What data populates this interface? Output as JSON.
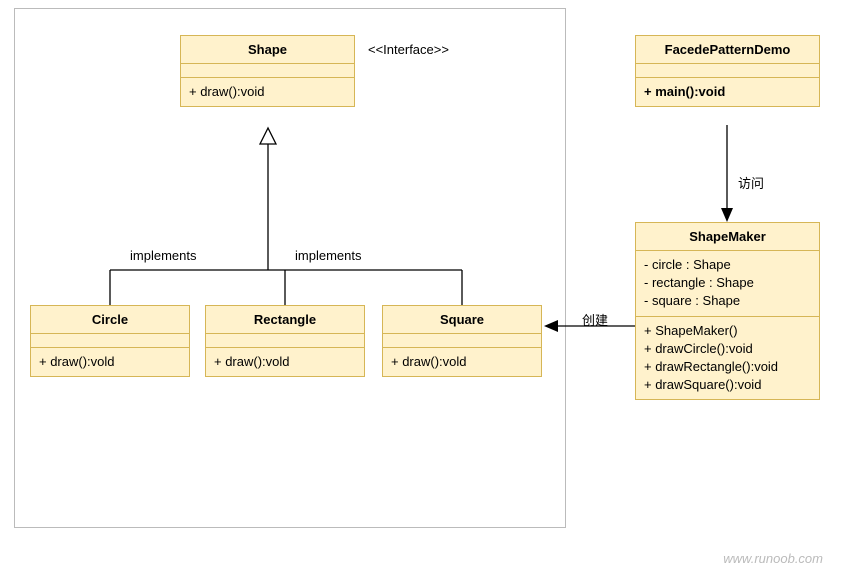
{
  "interfaceLabel": "<<Interface>>",
  "implementsLabel": "implements",
  "visitLabel": "访问",
  "createLabel": "创建",
  "attribution": "www.runoob.com",
  "shape": {
    "name": "Shape",
    "method1": "+ draw():void"
  },
  "circle": {
    "name": "Circle",
    "method1": "+ draw():vold"
  },
  "rectangle": {
    "name": "Rectangle",
    "method1": "+ draw():vold"
  },
  "square": {
    "name": "Square",
    "method1": "+ draw():vold"
  },
  "demo": {
    "name": "FacedePatternDemo",
    "method1": "+ main():void"
  },
  "maker": {
    "name": "ShapeMaker",
    "attr1": "- circle : Shape",
    "attr2": "- rectangle : Shape",
    "attr3": "- square : Shape",
    "method1": "+ ShapeMaker()",
    "method2": "+ drawCircle():void",
    "method3": "+ drawRectangle():void",
    "method4": "+ drawSquare():void"
  }
}
